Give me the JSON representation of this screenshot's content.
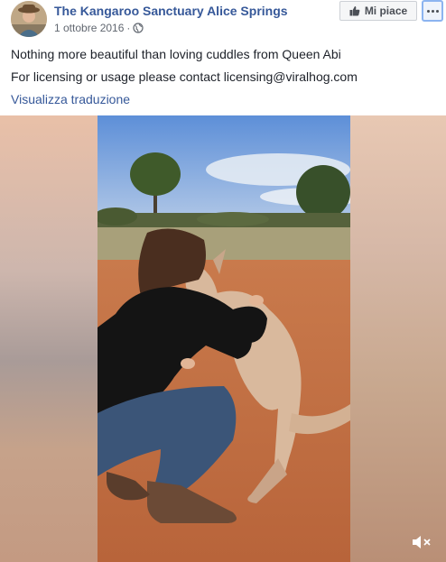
{
  "header": {
    "page_name": "The Kangaroo Sanctuary Alice Springs",
    "date": "1 ottobre 2016",
    "separator": "·",
    "like_label": "Mi piace"
  },
  "post": {
    "line1": "Nothing more beautiful than loving cuddles from Queen Abi",
    "line2": "For licensing or usage please contact licensing@viralhog.com",
    "translate_label": "Visualizza traduzione"
  },
  "video": {
    "muted": true
  },
  "colors": {
    "link": "#365899",
    "text": "#1d2129",
    "meta": "#616770"
  }
}
